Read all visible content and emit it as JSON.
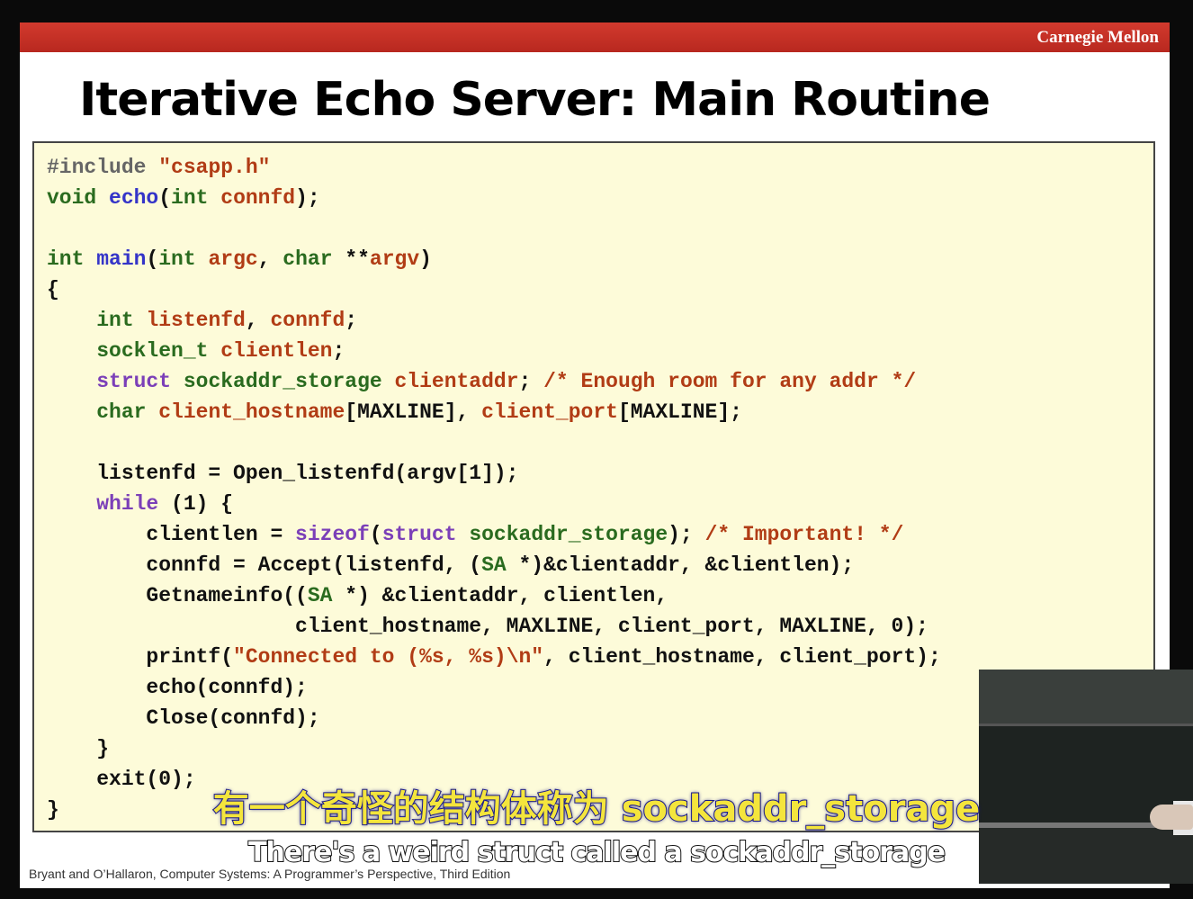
{
  "slide": {
    "institution": "Carnegie Mellon",
    "title": "Iterative Echo Server: Main Routine",
    "footer": "Bryant and O’Hallaron, Computer Systems: A Programmer’s Perspective, Third Edition"
  },
  "code": {
    "lines": [
      "#include \"csapp.h\"",
      "void echo(int connfd);",
      "",
      "int main(int argc, char **argv)",
      "{",
      "    int listenfd, connfd;",
      "    socklen_t clientlen;",
      "    struct sockaddr_storage clientaddr; /* Enough room for any addr */",
      "    char client_hostname[MAXLINE], client_port[MAXLINE];",
      "",
      "    listenfd = Open_listenfd(argv[1]);",
      "    while (1) {",
      "        clientlen = sizeof(struct sockaddr_storage); /* Important! */",
      "        connfd = Accept(listenfd, (SA *)&clientaddr, &clientlen);",
      "        Getnameinfo((SA *) &clientaddr, clientlen,",
      "                    client_hostname, MAXLINE, client_port, MAXLINE, 0);",
      "        printf(\"Connected to (%s, %s)\\n\", client_hostname, client_port);",
      "        echo(connfd);",
      "        Close(connfd);",
      "    }",
      "    exit(0);",
      "}"
    ]
  },
  "subtitles": {
    "zh": "有一个奇怪的结构体称为 sockaddr_storage",
    "en": "There's a weird struct called a sockaddr_storage"
  }
}
